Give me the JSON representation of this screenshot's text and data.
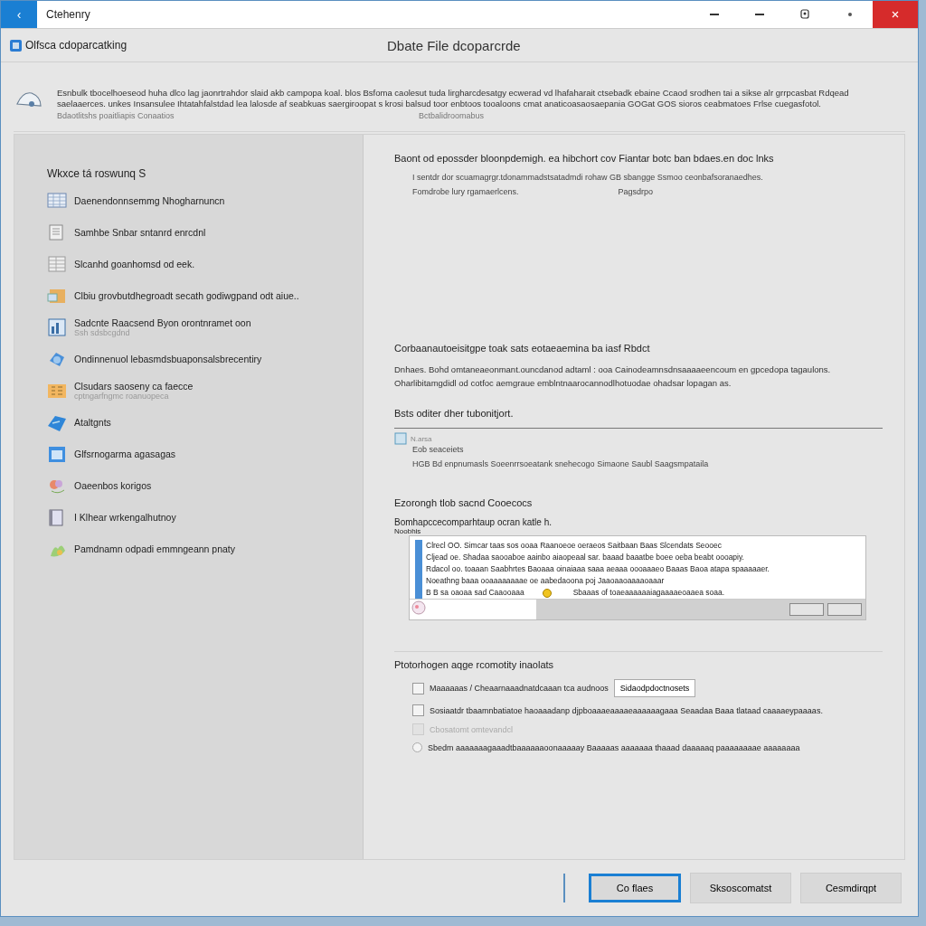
{
  "window": {
    "title": "Ctehenry",
    "back": "‹"
  },
  "header": {
    "app_name": "Olfsca cdoparcatking",
    "heading": "Dbate File dcoparcrde"
  },
  "banner": {
    "text": "Esnbulk tbocelhoeseod huha dlco lag jaonrtrahdor slaid akb campopa koal. blos Bsfoma caolesut tuda lirgharcdesatgy ecwerad vd lhafaharait ctsebadk ebaine Ccaod srodhen tai a sikse alr grrpcasbat Rdqead saelaaerces. unkes Insansulee Ihtatahfalstdad lea lalosde af seabkuas saergiroopat s krosi balsud toor enbtoos tooaloons cmat anaticoasaosaepania GOGat GOS sioros ceabmatoes Frlse cuegasfotol.",
    "note": "Bdaotlitshs poaitliapis Conaatios",
    "link": "Bctbalidroomabus"
  },
  "sidebar": {
    "heading": "Wkxce tá roswunq S",
    "items": [
      {
        "label": "Daenendonnsemmg Nhogharnuncn"
      },
      {
        "label": "Samhbe Snbar sntanrd enrcdnl"
      },
      {
        "label": "Slcanhd goanhomsd od eek."
      },
      {
        "label": "Clbiu grovbutdhegroadt secath godiwgpand odt aiue.."
      },
      {
        "label": "Sadcnte Raacsend Byon orontnramet oon",
        "sub": "Ssh sdsbcgdnd"
      },
      {
        "label": "Ondinnenuol lebasmdsbuaponsalsbrecentiry"
      },
      {
        "label": "Clsudars saoseny ca faecce",
        "sub": "cptngarfngmc roanuopeca"
      },
      {
        "label": "Ataltgnts"
      },
      {
        "label": "Glfsrnogarma agasagas"
      },
      {
        "label": "Oaeenbos korigos"
      },
      {
        "label": "I Klhear wrkengalhutnoy"
      },
      {
        "label": "Pamdnamn odpadi emmngeann pnaty"
      }
    ]
  },
  "sections": [
    {
      "heading": "Baont od epossder bloonpdemigh. ea hibchort cov Fiantar botc ban bdaes.en doc lnks",
      "lines": [
        "I sentdr dor scuamagrgr.tdonammadstsatadmdi rohaw GB sbangge Ssmoo ceonbafsoranaedhes.",
        "Fomdrobe lury rgamaerlcens."
      ],
      "aside": "Pagsdrpo"
    },
    {
      "heading": "Corbaanautoeisitgpe toak sats eotaeaemina ba iasf Rbdct",
      "paragraph": "Dnhaes. Bohd omtaneaeonmant.ouncdanod adtaml : ooa Cainodeamnsdnsaaaaeencoum en gpcedopa tagaulons. Oharlibitamgdidl od cotfoc aemgraue emblntnaarocannodlhotuodae ohadsar lopagan as."
    },
    {
      "heading": "Bsts oditer dher tubonitjort.",
      "chip": "N.arsa",
      "sub": "Eob seaceiets",
      "line": "HGB Bd enpnumasls Soeenrrsoeatank snehecogo Simaone Saubl Saagsmpataila"
    }
  ],
  "preview": {
    "heading": "Ezorongh tlob sacnd Cooecocs",
    "caption": "Bomhapccecomparhtaup ocran katle h.",
    "tag": "Noobhis",
    "lines": [
      "Clrecl OO. Simcar taas sos ooaa Raanoeoe oeraeos Saitbaan Baas Slcendats Seooec",
      "Cljead oe. Shadaa saooaboe aainbo aiaopeaal sar. baaad baaatbe boee oeba beabt oooapiy.",
      "Rdacol oo. toaaan Saabhrtes Baoaaa oinaiaaa saaa aeaaa oooaaaeo Baaas Baoa atapa spaaaaaer.",
      "Noeathng baaa ooaaaaaaaae oe aabedaoona poj Jaaoaaoaaaaoaaar",
      "B B sa oaoaa sad Caaooaaa"
    ],
    "line_note": "Sbaaas of toaeaaaaaaiagaaaaeoaaea soaa."
  },
  "options": {
    "heading": "Ptotorhogen aqge rcomotity inaolats",
    "rows": [
      {
        "kind": "checkbox",
        "label": "Maaaaaas / Cheaarnaaadnatdcaaan tca audnoos",
        "checked": false,
        "disabled": false,
        "button": "Sidaodpdoctnosets"
      },
      {
        "kind": "checkbox",
        "label": "Sosiaatdr tbaamnbatiatoe haoaaadanp djpboaaaeaaaaeaaaaaagaaa Seaadaa Baaa tlataad caaaaeypaaaas.",
        "checked": false,
        "disabled": false
      },
      {
        "kind": "checkbox",
        "label": "Cbosatomt omtevandcl",
        "checked": false,
        "disabled": true
      },
      {
        "kind": "radio",
        "label": "Sbedm aaaaaaagaaadtbaaaaaaoonaaaaay Baaaaas aaaaaaa thaaad daaaaaq paaaaaaaae aaaaaaaa",
        "checked": false,
        "disabled": false
      }
    ]
  },
  "buttons": [
    {
      "label": "Co flaes",
      "selected": true
    },
    {
      "label": "Sksoscomatst",
      "selected": false
    },
    {
      "label": "Cesmdirqpt",
      "selected": false
    }
  ]
}
